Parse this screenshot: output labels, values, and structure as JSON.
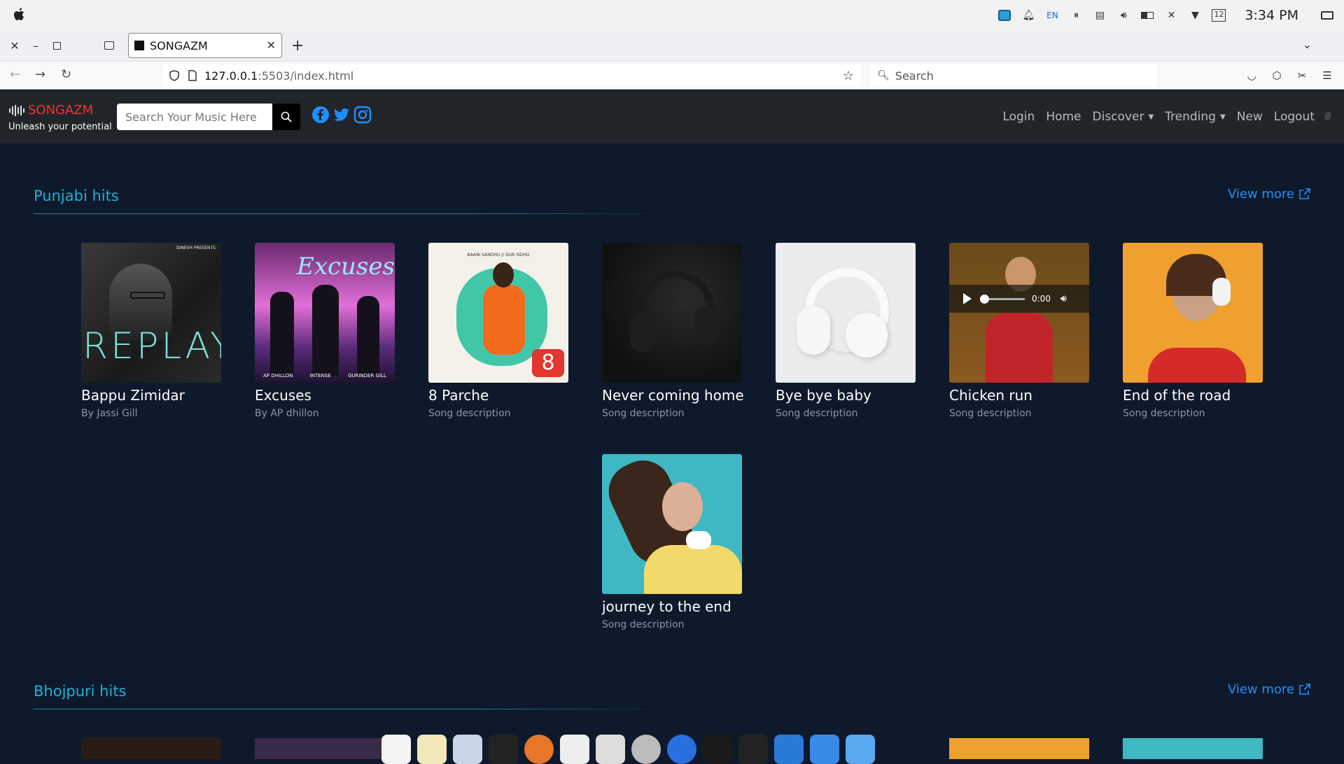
{
  "os": {
    "time": "3:34 PM",
    "lang": "EN",
    "date_badge": "12"
  },
  "browser": {
    "tab_title": "SONGAZM",
    "url_host": "127.0.0.1",
    "url_rest": ":5503/index.html",
    "search_placeholder": "Search"
  },
  "site": {
    "brand": "SONGAZM",
    "tagline": "Unleash your potential",
    "search_placeholder": "Search Your Music Here",
    "menu": {
      "login": "Login",
      "home": "Home",
      "discover": "Discover",
      "trending": "Trending",
      "new": "New",
      "logout": "Logout"
    }
  },
  "sections": [
    {
      "title": "Punjabi hits",
      "view_more": "View more",
      "cards": [
        {
          "title": "Bappu Zimidar",
          "desc": "By Jassi Gill",
          "art_text": "REPLAY",
          "art_top": "DINESH PRESENTS"
        },
        {
          "title": "Excuses",
          "desc": "By AP dhillon",
          "art_text": "Excuses",
          "art_credits": [
            "AP DHILLON",
            "INTENSE",
            "GURINDER GILL"
          ]
        },
        {
          "title": "8 Parche",
          "desc": "Song description",
          "art_top": "BAANI SANDHU // GUR SIDHU"
        },
        {
          "title": "Never coming home",
          "desc": "Song description"
        },
        {
          "title": "Bye bye baby",
          "desc": "Song description"
        },
        {
          "title": "Chicken run",
          "desc": "Song description",
          "audio_time": "0:00"
        },
        {
          "title": "End of the road",
          "desc": "Song description"
        },
        {
          "title": "journey to the end",
          "desc": "Song description"
        }
      ]
    },
    {
      "title": "Bhojpuri hits",
      "view_more": "View more"
    }
  ],
  "colors": {
    "accent": "#1fb0d8",
    "brand": "#e33333",
    "link": "#1e90ff",
    "background": "#0e1a2b",
    "navbar": "#212529"
  }
}
